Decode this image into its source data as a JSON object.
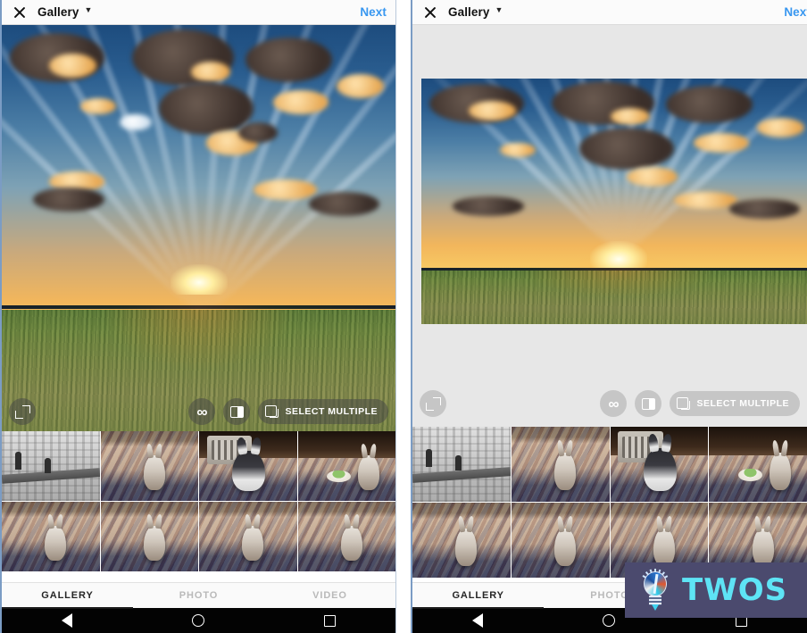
{
  "app": {
    "header": {
      "close_icon": "close-icon",
      "title": "Gallery",
      "caret_icon": "chevron-down-icon",
      "next_label": "Next",
      "next_label_clipped": "Nex",
      "next_color": "#3897f0"
    },
    "overlay_controls": {
      "expand_icon": "expand-corners-icon",
      "boomerang_icon": "infinity-icon",
      "boomerang_glyph": "∞",
      "layout_icon": "layout-split-icon",
      "select_multiple_icon": "stacked-squares-icon",
      "select_multiple_label": "SELECT MULTIPLE"
    },
    "tabs": [
      {
        "label": "GALLERY",
        "active": true
      },
      {
        "label": "PHOTO",
        "active": false
      },
      {
        "label": "VIDEO",
        "active": false
      }
    ],
    "nav_bar": {
      "back_icon": "triangle-back-icon",
      "home_icon": "circle-home-icon",
      "recents_icon": "square-recents-icon"
    },
    "preview": {
      "description": "sunset-over-field-photo"
    },
    "thumbnails": [
      {
        "name": "city-beam-black-and-white",
        "kind": "city"
      },
      {
        "name": "rabbit-on-carpet-1",
        "kind": "rabbit"
      },
      {
        "name": "rabbit-with-crate",
        "kind": "crate"
      },
      {
        "name": "rabbit-with-food-bowl",
        "kind": "bowl"
      },
      {
        "name": "rabbit-on-carpet-2",
        "kind": "rabbit"
      },
      {
        "name": "rabbit-on-carpet-3",
        "kind": "rabbit"
      },
      {
        "name": "rabbit-on-carpet-4",
        "kind": "rabbit"
      },
      {
        "name": "rabbit-on-carpet-5",
        "kind": "rabbit"
      }
    ]
  },
  "watermark": {
    "text": "TWOS",
    "icon": "lightbulb-icon",
    "background_color": "#4b4a6e",
    "text_color": "#5ee4f5"
  }
}
